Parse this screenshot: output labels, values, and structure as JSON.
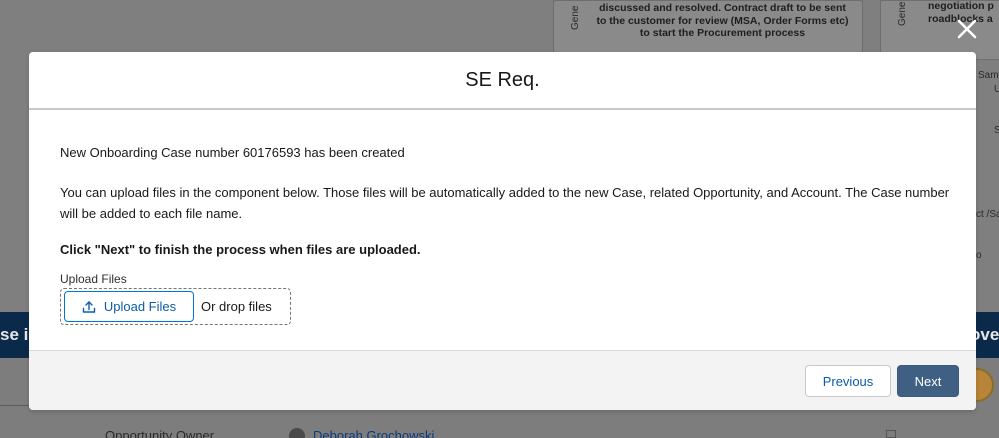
{
  "background": {
    "card_a_vertical_label": "Gene",
    "card_a_text": "discussed and resolved. Contract draft to be sent to the customer for review (MSA, Order Forms etc) to start the Procurement process",
    "card_b_vertical_label": "Gene",
    "card_b_text_line1": "negotiation p",
    "card_b_text_line2": "roadblocks a",
    "right_fragments": [
      "Sam",
      "U",
      "S",
      "ct /Sa",
      "o"
    ],
    "banner_left": "se is",
    "banner_right": "ove",
    "owner_label": "Opportunity Owner",
    "owner_name": "Deborah Grochowski",
    "colors": {
      "banner": "#0b2a4a",
      "overlay": "#7f7f7f"
    }
  },
  "close_icon": "close-icon",
  "modal": {
    "title": "SE Req.",
    "case_message": "New Onboarding Case number 60176593 has been created",
    "upload_description": "You can upload files in the component below. Those files will be automatically added to the new Case, related Opportunity, and Account. The Case number will be added to each file name.",
    "instruction": "Click \"Next\" to finish the process when files are uploaded.",
    "upload": {
      "label": "Upload Files",
      "button_label": "Upload Files",
      "button_icon": "upload-icon",
      "drop_text": "Or drop files"
    },
    "footer": {
      "previous_label": "Previous",
      "next_label": "Next"
    },
    "colors": {
      "brand_blue": "#0176d3",
      "link_blue": "#0b5cab",
      "next_button": "#3f5f83",
      "footer_bg": "#f3f3f3"
    }
  }
}
